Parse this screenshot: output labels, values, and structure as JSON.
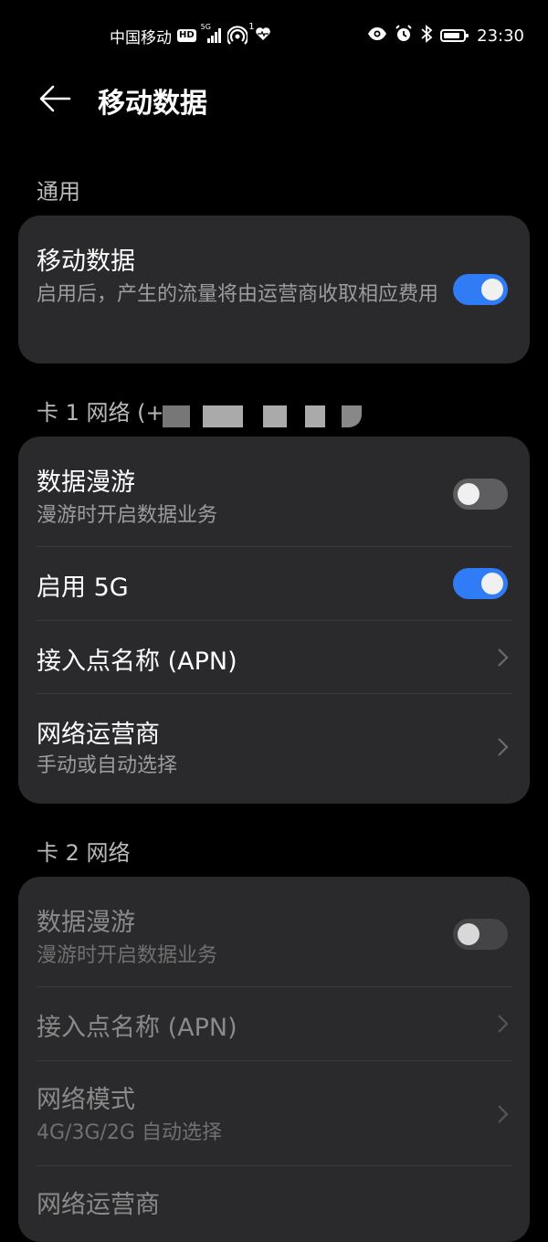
{
  "status_bar": {
    "carrier": "中国移动",
    "hd_badge": "HD",
    "network_type": "5G",
    "hotspot_count": "1",
    "time": "23:30",
    "icons": [
      "signal-icon",
      "hotspot-icon",
      "heart-health-icon",
      "eye-comfort-icon",
      "alarm-icon",
      "bluetooth-icon",
      "battery-icon"
    ]
  },
  "header": {
    "title": "移动数据",
    "back_icon": "back-arrow-icon"
  },
  "sections": {
    "general": {
      "label": "通用",
      "mobile_data": {
        "title": "移动数据",
        "subtitle": "启用后，产生的流量将由运营商收取相应费用",
        "enabled": true
      }
    },
    "card1": {
      "label": "卡 1 网络 (+",
      "roaming": {
        "title": "数据漫游",
        "subtitle": "漫游时开启数据业务",
        "enabled": false
      },
      "enable_5g": {
        "title": "启用 5G",
        "enabled": true
      },
      "apn": {
        "title": "接入点名称 (APN)"
      },
      "carrier": {
        "title": "网络运营商",
        "subtitle": "手动或自动选择"
      }
    },
    "card2": {
      "label": "卡 2 网络",
      "roaming": {
        "title": "数据漫游",
        "subtitle": "漫游时开启数据业务",
        "enabled": false
      },
      "apn": {
        "title": "接入点名称 (APN)"
      },
      "network_mode": {
        "title": "网络模式",
        "subtitle": "4G/3G/2G 自动选择"
      },
      "carrier": {
        "title": "网络运营商"
      }
    }
  },
  "colors": {
    "background": "#000000",
    "card": "#2a2a2c",
    "accent": "#2f7cf6",
    "secondary_text": "#9c9c9c"
  }
}
